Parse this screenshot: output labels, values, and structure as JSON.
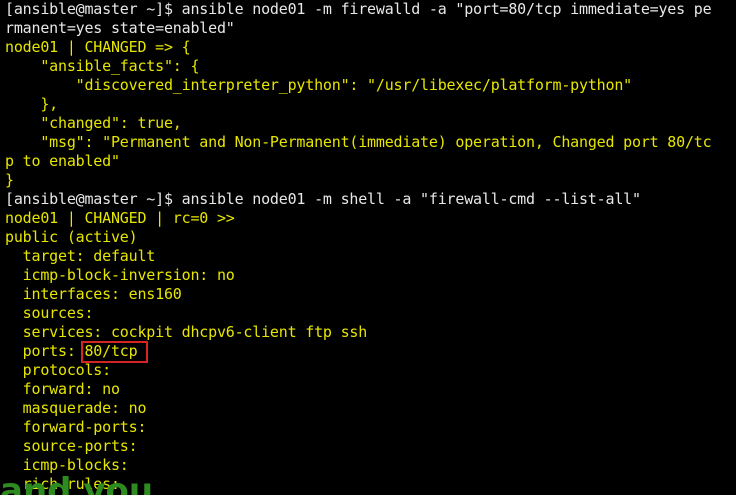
{
  "terminal": {
    "lines": [
      {
        "text": "[ansible@master ~]$ ansible node01 -m firewalld -a \"port=80/tcp immediate=yes pe",
        "color": "white"
      },
      {
        "text": "rmanent=yes state=enabled\"",
        "color": "white"
      },
      {
        "text": "node01 | CHANGED => {",
        "color": "yellow"
      },
      {
        "text": "    \"ansible_facts\": {",
        "color": "yellow"
      },
      {
        "text": "        \"discovered_interpreter_python\": \"/usr/libexec/platform-python\"",
        "color": "yellow"
      },
      {
        "text": "    },",
        "color": "yellow"
      },
      {
        "text": "    \"changed\": true,",
        "color": "yellow"
      },
      {
        "text": "    \"msg\": \"Permanent and Non-Permanent(immediate) operation, Changed port 80/tc",
        "color": "yellow"
      },
      {
        "text": "p to enabled\"",
        "color": "yellow"
      },
      {
        "text": "}",
        "color": "yellow"
      },
      {
        "text": "[ansible@master ~]$ ansible node01 -m shell -a \"firewall-cmd --list-all\"",
        "color": "white"
      },
      {
        "text": "node01 | CHANGED | rc=0 >>",
        "color": "yellow"
      },
      {
        "text": "public (active)",
        "color": "yellow"
      },
      {
        "text": "  target: default",
        "color": "yellow"
      },
      {
        "text": "  icmp-block-inversion: no",
        "color": "yellow"
      },
      {
        "text": "  interfaces: ens160",
        "color": "yellow"
      },
      {
        "text": "  sources:",
        "color": "yellow"
      },
      {
        "text": "  services: cockpit dhcpv6-client ftp ssh",
        "color": "yellow"
      },
      {
        "text": "  ports: 80/tcp",
        "color": "yellow"
      },
      {
        "text": "  protocols:",
        "color": "yellow"
      },
      {
        "text": "  forward: no",
        "color": "yellow"
      },
      {
        "text": "  masquerade: no",
        "color": "yellow"
      },
      {
        "text": "  forward-ports:",
        "color": "yellow"
      },
      {
        "text": "  source-ports:",
        "color": "yellow"
      },
      {
        "text": "  icmp-blocks:",
        "color": "yellow"
      },
      {
        "text": "  rich rules:",
        "color": "yellow"
      }
    ],
    "colors": {
      "background": "#000000",
      "command": "#e8e8e8",
      "output": "#e6e600",
      "highlight_border": "#d42424",
      "overlay_text": "#2e8b1f"
    }
  },
  "overlay": {
    "text": "and you"
  }
}
